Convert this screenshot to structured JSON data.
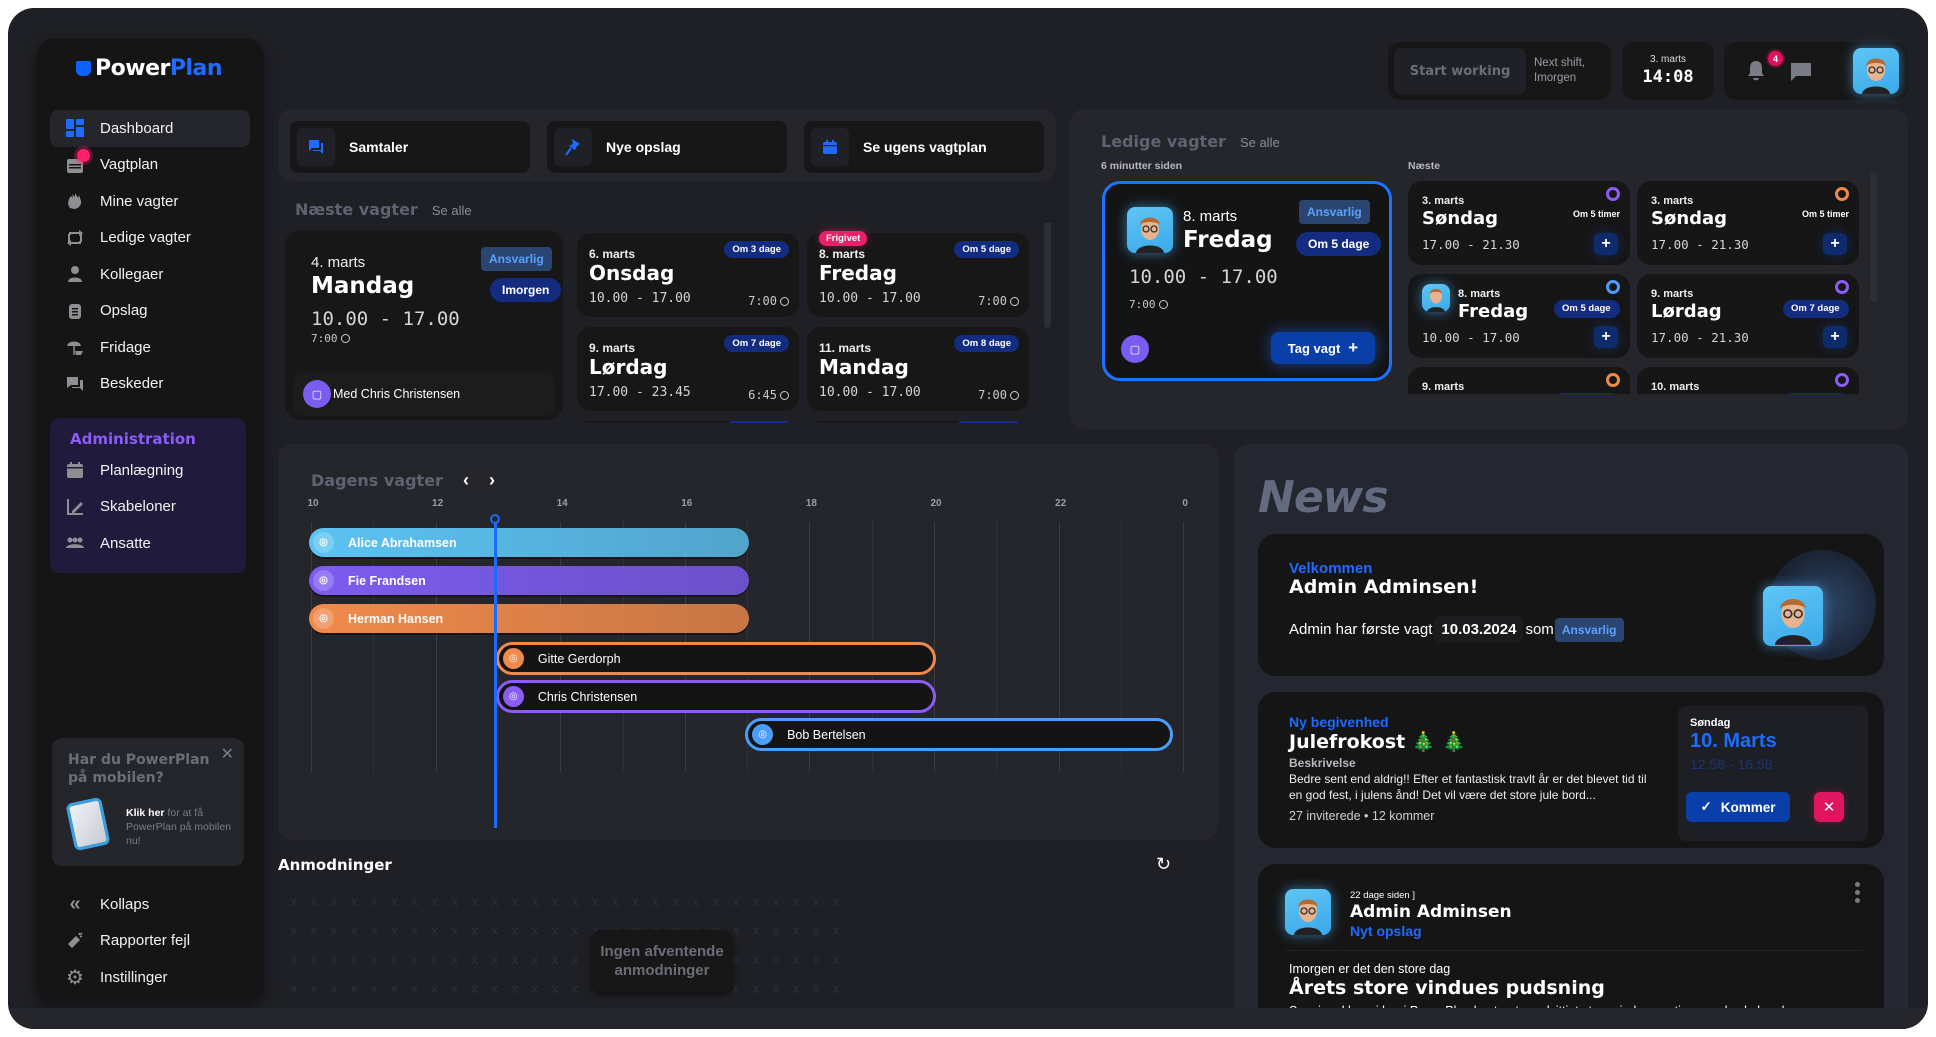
{
  "app": {
    "logo_part1": "Power",
    "logo_part2": "Plan"
  },
  "sidebar": {
    "items": [
      {
        "label": "Dashboard",
        "icon": "dashboard-icon",
        "active": true
      },
      {
        "label": "Vagtplan",
        "icon": "calendar-icon",
        "has_badge": true
      },
      {
        "label": "Mine vagter",
        "icon": "hand-wave-icon"
      },
      {
        "label": "Ledige vagter",
        "icon": "swap-icon"
      },
      {
        "label": "Kollegaer",
        "icon": "person-icon"
      },
      {
        "label": "Opslag",
        "icon": "clipboard-icon"
      },
      {
        "label": "Fridage",
        "icon": "beach-umbrella-icon"
      },
      {
        "label": "Beskeder",
        "icon": "messages-icon"
      }
    ],
    "admin": {
      "title": "Administration",
      "items": [
        {
          "label": "Planlægning",
          "icon": "calendar-icon"
        },
        {
          "label": "Skabeloner",
          "icon": "ruler-pencil-icon"
        },
        {
          "label": "Ansatte",
          "icon": "group-icon"
        }
      ]
    },
    "promo": {
      "title": "Har du PowerPlan på mobilen?",
      "cta": "Klik her",
      "text": " for at få PowerPlan på mobilen nu!"
    },
    "bottom": [
      {
        "label": "Kollaps",
        "icon": "double-chevron-left-icon"
      },
      {
        "label": "Rapporter fejl",
        "icon": "megaphone-icon"
      },
      {
        "label": "Instillinger",
        "icon": "gear-icon"
      }
    ]
  },
  "topbar": {
    "start_working": "Start working",
    "next_shift_line1": "Next shift,",
    "next_shift_line2": "Imorgen",
    "clock_date": "3. marts",
    "clock_time": "14:08",
    "notifications": "4"
  },
  "quick_actions": [
    {
      "label": "Samtaler",
      "icon": "chat-icon"
    },
    {
      "label": "Nye opslag",
      "icon": "pin-icon"
    },
    {
      "label": "Se ugens vagtplan",
      "icon": "calendar-icon"
    }
  ],
  "next_shifts": {
    "title": "Næste vagter",
    "see_all": "Se alle",
    "featured": {
      "date": "4. marts",
      "day": "Mandag",
      "time": "10.00 - 17.00",
      "duration": "7:00",
      "role": "Ansvarlig",
      "when": "Imorgen",
      "with": "Med Chris Christensen"
    },
    "items": [
      {
        "date": "6. marts",
        "day": "Onsdag",
        "time": "10.00 - 17.00",
        "duration": "7:00",
        "when": "Om 3 dage"
      },
      {
        "date": "8. marts",
        "day": "Fredag",
        "time": "10.00 - 17.00",
        "duration": "7:00",
        "when": "Om 5 dage",
        "flag": "Frigivet"
      },
      {
        "date": "9. marts",
        "day": "Lørdag",
        "time": "17.00 - 23.45",
        "duration": "6:45",
        "when": "Om 7 dage"
      },
      {
        "date": "11. marts",
        "day": "Mandag",
        "time": "10.00 - 17.00",
        "duration": "7:00",
        "when": "Om 8 dage"
      }
    ]
  },
  "available_shifts": {
    "title": "Ledige vagter",
    "see_all": "Se alle",
    "updated": "6 minutter siden",
    "featured": {
      "date": "8. marts",
      "day": "Fredag",
      "time": "10.00 - 17.00",
      "duration": "7:00",
      "role": "Ansvarlig",
      "when": "Om 5 dage",
      "take_label": "Tag vagt"
    },
    "next_label": "Næste",
    "items": [
      {
        "date": "3. marts",
        "day": "Søndag",
        "time": "17.00 - 21.30",
        "when": "Om 5 timer",
        "color": "#8b5cf6",
        "style": "text"
      },
      {
        "date": "3. marts",
        "day": "Søndag",
        "time": "17.00 - 21.30",
        "when": "Om 5 timer",
        "color": "#f08a4b",
        "style": "text"
      },
      {
        "date": "8. marts",
        "day": "Fredag",
        "time": "10.00 - 17.00",
        "when": "Om 5 dage",
        "color": "#4a9df8",
        "style": "pill",
        "avatar": true
      },
      {
        "date": "9. marts",
        "day": "Lørdag",
        "time": "17.00 - 21.30",
        "when": "Om 7 dage",
        "color": "#8b5cf6",
        "style": "pill"
      },
      {
        "date": "9. marts",
        "day": "",
        "time": "",
        "when": "",
        "color": "#f08a4b",
        "style": "pill"
      },
      {
        "date": "10. marts",
        "day": "",
        "time": "",
        "when": "",
        "color": "#8b5cf6",
        "style": "pill"
      }
    ]
  },
  "todays_shifts": {
    "title": "Dagens vagter",
    "hours": [
      "10",
      "12",
      "14",
      "16",
      "18",
      "20",
      "22",
      "0"
    ],
    "now_hour": 12.95,
    "shifts": [
      {
        "name": "Alice Abrahamsen",
        "start": 10,
        "end": 17,
        "color": "#5cc3f3",
        "style": "filled"
      },
      {
        "name": "Fie Frandsen",
        "start": 10,
        "end": 17,
        "color": "#7c5cf0",
        "style": "filled"
      },
      {
        "name": "Herman Hansen",
        "start": 10,
        "end": 17,
        "color": "#f08a4b",
        "style": "filled"
      },
      {
        "name": "Gitte Gerdorph",
        "start": 13,
        "end": 20,
        "color": "#f08a4b",
        "style": "outline"
      },
      {
        "name": "Chris Christensen",
        "start": 13,
        "end": 20,
        "color": "#8b5cf6",
        "style": "outline"
      },
      {
        "name": "Bob Bertelsen",
        "start": 17,
        "end": 23.8,
        "color": "#4a9df8",
        "style": "outline"
      }
    ]
  },
  "requests": {
    "title": "Anmodninger",
    "empty": "Ingen afventende anmodninger"
  },
  "news": {
    "title": "News",
    "welcome": {
      "label": "Velkommen",
      "name": "Admin Adminsen!",
      "text_before": "Admin har første vagt",
      "date": "10.03.2024",
      "text_mid": "som",
      "role": "Ansvarlig"
    },
    "event": {
      "label": "Ny begivenhed",
      "title": "Julefrokost 🎄 🎄",
      "desc_label": "Beskrivelse",
      "desc": "Bedre sent end aldrig!! Efter et fantastisk travlt år er det blevet tid til en god fest, i julens ånd! Det vil være det store jule bord...",
      "stats": "27 inviterede • 12 kommer",
      "weekday": "Søndag",
      "date": "10. Marts",
      "time": "12.58 - 16.58",
      "accept": "Kommer"
    },
    "post": {
      "ago": "22 dage siden ]",
      "author": "Admin Adminsen",
      "type": "Nyt opslag",
      "intro": "Imorgen er det den store dag",
      "title": "Årets store vindues pudsning",
      "body": "Som i ved har vi her i PowerPlan kontoret vandvittigt store vinduespartier - og de skal pudses"
    }
  },
  "colors": {
    "accent": "#1f6bff",
    "admin": "#8b5cf6",
    "danger": "#e0155f",
    "pill": "#142c80"
  }
}
